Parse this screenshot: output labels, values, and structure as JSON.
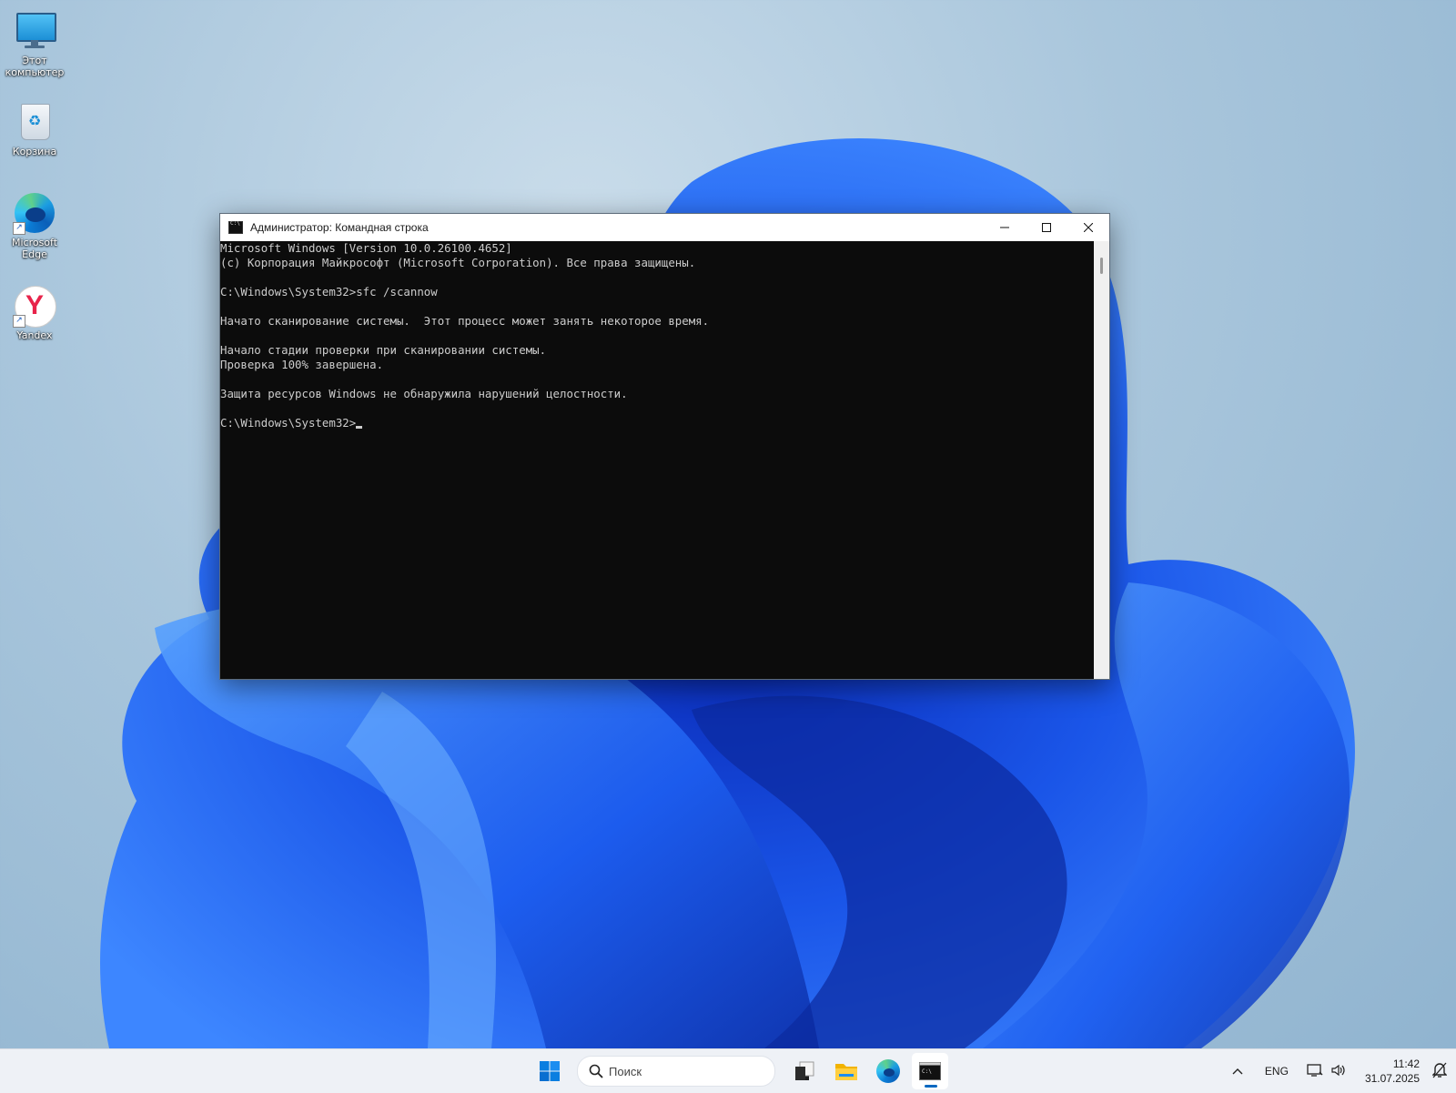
{
  "desktop": {
    "icons": [
      {
        "label": "Этот компьютер"
      },
      {
        "label": "Корзина"
      },
      {
        "label": "Microsoft Edge"
      },
      {
        "label": "Yandex"
      }
    ]
  },
  "window": {
    "title": "Администратор: Командная строка",
    "buttons": {
      "minimize": "—",
      "maximize": "☐",
      "close": "✕"
    },
    "console_lines": [
      "Microsoft Windows [Version 10.0.26100.4652]",
      "(c) Корпорация Майкрософт (Microsoft Corporation). Все права защищены.",
      "",
      "C:\\Windows\\System32>sfc /scannow",
      "",
      "Начато сканирование системы.  Этот процесс может занять некоторое время.",
      "",
      "Начало стадии проверки при сканировании системы.",
      "Проверка 100% завершена.",
      "",
      "Защита ресурсов Windows не обнаружила нарушений целостности.",
      "",
      "C:\\Windows\\System32>"
    ]
  },
  "taskbar": {
    "search_placeholder": "Поиск",
    "apps": [
      "start-icon",
      "task-view-icon",
      "file-explorer-icon",
      "edge-icon",
      "terminal-icon"
    ],
    "tray": {
      "chevron": "^",
      "language": "ENG",
      "time": "11:42",
      "date": "31.07.2025"
    }
  },
  "colors": {
    "console_bg": "#0c0c0c",
    "console_fg": "#cccccc",
    "accent": "#0067c0",
    "wallpaper_bloom": "#1f5fe8"
  }
}
